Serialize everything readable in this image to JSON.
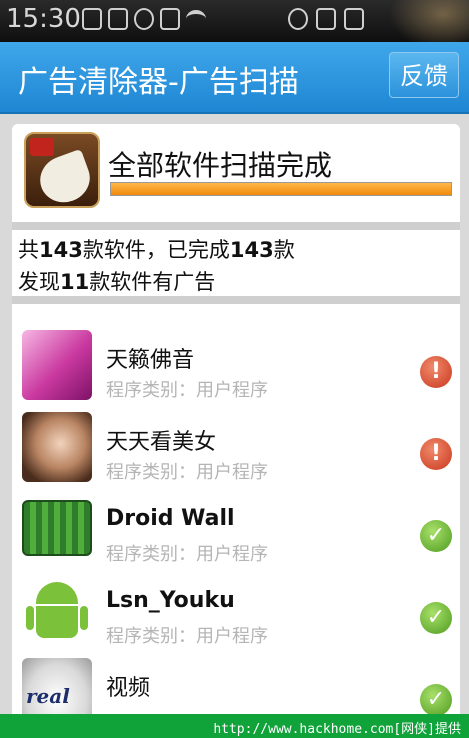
{
  "status_bar": {
    "time": "15:30"
  },
  "header": {
    "title": "广告清除器-广告扫描",
    "feedback_label": "反馈"
  },
  "scan": {
    "status_text": "全部软件扫描完成",
    "progress": 1.0
  },
  "summary": {
    "line1_prefix": "共",
    "line1_total": "143",
    "line1_mid": "款软件，已完成",
    "line1_done": "143",
    "line1_suffix": "款",
    "line2_prefix": "发现",
    "line2_count": "11",
    "line2_suffix": "款软件有广告"
  },
  "apps": [
    {
      "name": "天籁佛音",
      "type": "程序类别：用户程序",
      "status": "has-ads",
      "icon": "buddha-music-icon"
    },
    {
      "name": "天天看美女",
      "type": "程序类别：用户程序",
      "status": "has-ads",
      "icon": "beauty-photo-icon"
    },
    {
      "name": "Droid Wall",
      "type": "程序类别：用户程序",
      "status": "clean",
      "icon": "droidwall-icon"
    },
    {
      "name": "Lsn_Youku",
      "type": "程序类别：用户程序",
      "status": "clean",
      "icon": "android-icon"
    },
    {
      "name": "视频",
      "type": "",
      "status": "clean",
      "icon": "realplayer-icon"
    }
  ],
  "banner": {
    "text": "http://www.hackhome.com[网侠]提供"
  },
  "colors": {
    "header": "#2b93dc",
    "warn": "#d0422a",
    "ok": "#5ea82a",
    "progress": "#f39a1d",
    "banner": "#10a33a"
  }
}
